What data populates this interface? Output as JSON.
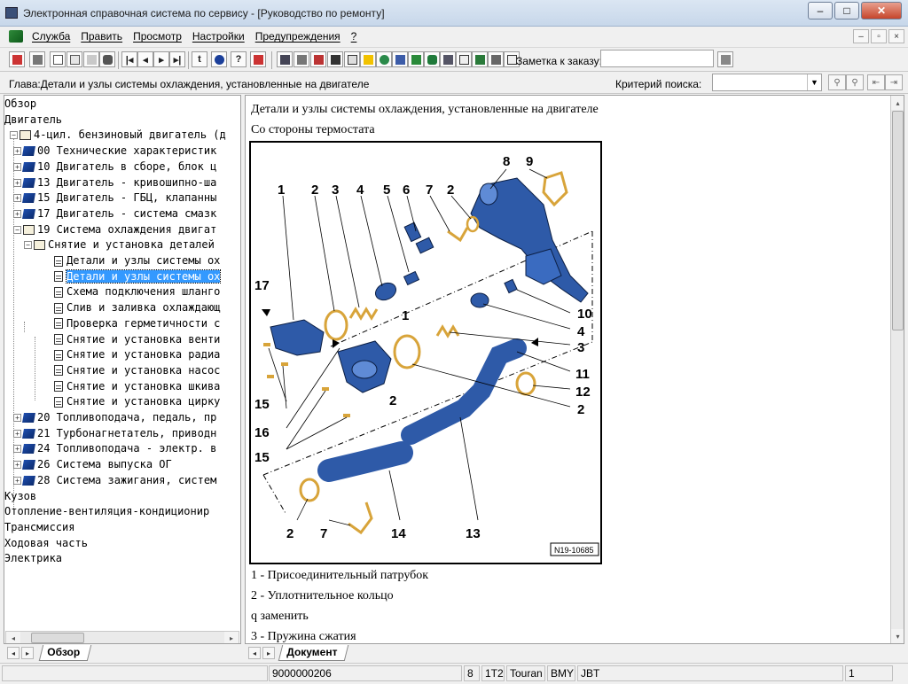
{
  "window": {
    "title": "Электронная справочная система по сервису - [Руководство по ремонту]",
    "controls": [
      "–",
      "□",
      "✕"
    ]
  },
  "menu": {
    "items": [
      "Служба",
      "Править",
      "Просмотр",
      "Настройки",
      "Предупреждения",
      "?"
    ]
  },
  "toolbar": {
    "note_label": "Заметка к заказу:",
    "note_value": ""
  },
  "chapter": {
    "text": "Глава:Детали и узлы системы охлаждения, установленные на двигателе",
    "criteria_label": "Критерий  поиска:",
    "criteria_value": ""
  },
  "tree": {
    "rows": [
      {
        "text": "Обзор",
        "indent": 0,
        "icon": "none"
      },
      {
        "text": "Двигатель",
        "indent": 0,
        "icon": "none"
      },
      {
        "text": "4-цил. бензиновый двигатель (д",
        "indent": 1,
        "icon": "openbook",
        "exp": "−"
      },
      {
        "text": "00 Технические характеристик",
        "indent": 2,
        "icon": "book",
        "exp": "+"
      },
      {
        "text": "10 Двигатель в сборе, блок ц",
        "indent": 2,
        "icon": "book",
        "exp": "+"
      },
      {
        "text": "13 Двигатель - кривошипно-ша",
        "indent": 2,
        "icon": "book",
        "exp": "+"
      },
      {
        "text": "15 Двигатель - ГБЦ, клапанны",
        "indent": 2,
        "icon": "book",
        "exp": "+"
      },
      {
        "text": "17 Двигатель - система смазк",
        "indent": 2,
        "icon": "book",
        "exp": "+"
      },
      {
        "text": "19 Система охлаждения двигат",
        "indent": 2,
        "icon": "openbook",
        "exp": "−"
      },
      {
        "text": "Снятие и установка деталей",
        "indent": 3,
        "icon": "openbook",
        "exp": "−"
      },
      {
        "text": "Детали и узлы системы ох",
        "indent": 4,
        "icon": "doc"
      },
      {
        "text": "Детали и узлы системы ох",
        "indent": 4,
        "icon": "doc",
        "selected": true
      },
      {
        "text": "Схема подключения шланго",
        "indent": 4,
        "icon": "doc"
      },
      {
        "text": "Слив и заливка охлаждающ",
        "indent": 4,
        "icon": "doc"
      },
      {
        "text": "Проверка герметичности с",
        "indent": 4,
        "icon": "doc"
      },
      {
        "text": "Снятие и установка венти",
        "indent": 4,
        "icon": "doc"
      },
      {
        "text": "Снятие и установка радиа",
        "indent": 4,
        "icon": "doc"
      },
      {
        "text": "Снятие и установка насос",
        "indent": 4,
        "icon": "doc"
      },
      {
        "text": "Снятие и установка шкива",
        "indent": 4,
        "icon": "doc"
      },
      {
        "text": "Снятие и установка цирку",
        "indent": 4,
        "icon": "doc"
      },
      {
        "text": "20 Топливоподача, педаль, пр",
        "indent": 2,
        "icon": "book",
        "exp": "+"
      },
      {
        "text": "21 Турбонагнетатель, приводн",
        "indent": 2,
        "icon": "book",
        "exp": "+"
      },
      {
        "text": "24 Топливоподача - электр. в",
        "indent": 2,
        "icon": "book",
        "exp": "+"
      },
      {
        "text": "26 Система выпуска ОГ",
        "indent": 2,
        "icon": "book",
        "exp": "+"
      },
      {
        "text": "28 Система зажигания, систем",
        "indent": 2,
        "icon": "book",
        "exp": "+"
      },
      {
        "text": "Кузов",
        "indent": 0,
        "icon": "none"
      },
      {
        "text": "Отопление-вентиляция-кондиционир",
        "indent": 0,
        "icon": "none"
      },
      {
        "text": "Трансмиссия",
        "indent": 0,
        "icon": "none"
      },
      {
        "text": "Ходовая часть",
        "indent": 0,
        "icon": "none"
      },
      {
        "text": "Электрика",
        "indent": 0,
        "icon": "none"
      }
    ],
    "tab_label": "Обзор"
  },
  "document": {
    "heading": "Детали и узлы системы охлаждения, установленные на двигателе",
    "subheading": "Со стороны термостата",
    "figure_code": "N19-10685",
    "callouts": [
      "1",
      "2",
      "3",
      "4",
      "5",
      "6",
      "7",
      "2",
      "8",
      "9",
      "17",
      "1",
      "10",
      "4",
      "3",
      "11",
      "12",
      "2",
      "15",
      "16",
      "15",
      "2",
      "2",
      "7",
      "14",
      "13"
    ],
    "legend": [
      "1 -  Присоединительный патрубок",
      "2 -  Уплотнительное кольцо",
      "q   заменить",
      "3 -  Пружина сжатия"
    ],
    "tab_label": "Документ"
  },
  "status": {
    "cells": [
      "9000000206",
      "8",
      "1T2",
      "Touran",
      "BMY",
      "JBT",
      "1"
    ]
  },
  "colors": {
    "selection": "#3399ff",
    "part_blue": "#2e5aa8",
    "ring_gold": "#d8a43a"
  }
}
